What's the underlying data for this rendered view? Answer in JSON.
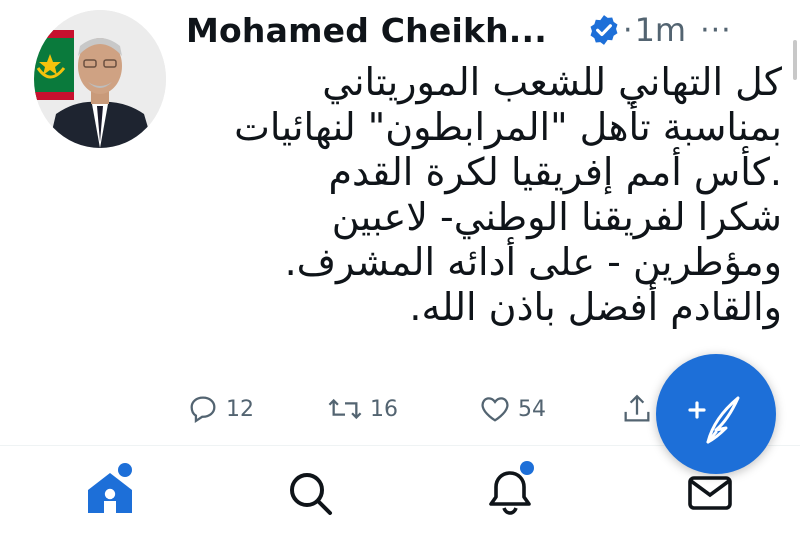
{
  "author": {
    "name": "Mohamed Cheikh...",
    "verified": true,
    "separator": "·",
    "time": "1m",
    "more": "···"
  },
  "tweet": {
    "lines": [
      "كل التهاني للشعب الموريتاني",
      "بمناسبة تأهل \"المرابطون\" لنهائيات",
      ".كأس أمم إفريقيا لكرة القدم",
      "شكرا لفريقنا الوطني- لاعبين",
      "ومؤطرين - على أدائه المشرف.",
      "والقادم أفضل باذن الله."
    ]
  },
  "actions": {
    "replies": "12",
    "retweets": "16",
    "likes": "54"
  },
  "colors": {
    "accent": "#1d6fd8",
    "muted": "#536471",
    "text": "#0f1419"
  },
  "nav": {
    "items": [
      {
        "icon": "home-icon",
        "active": true,
        "badge": true
      },
      {
        "icon": "search-icon",
        "active": false,
        "badge": false
      },
      {
        "icon": "bell-icon",
        "active": false,
        "badge": true
      },
      {
        "icon": "mail-icon",
        "active": false,
        "badge": false
      }
    ]
  },
  "fab": {
    "icon": "compose-tweet-icon"
  }
}
